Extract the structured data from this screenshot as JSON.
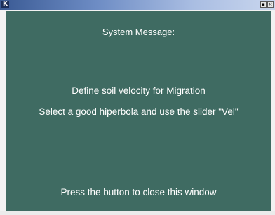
{
  "window": {
    "app_icon_glyph": "K",
    "title": "",
    "maximize_glyph": "▪",
    "close_glyph": "×"
  },
  "message": {
    "heading": "System Message:",
    "line1": "Define soil velocity for Migration",
    "line2": "Select a good hiperbola and use the slider \"Vel\"",
    "footer": "Press the button to close this window"
  },
  "colors": {
    "panel_background": "#3f6b62",
    "text": "#ffffff",
    "titlebar_start": "#3a5a94",
    "titlebar_end": "#c9d6ee"
  }
}
